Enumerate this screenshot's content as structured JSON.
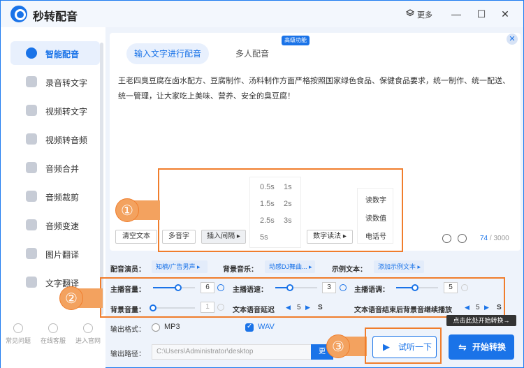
{
  "app": {
    "title": "秒转配音",
    "more": "更多",
    "min": "—",
    "max": "☐",
    "close": "✕"
  },
  "sidebar": {
    "items": [
      {
        "label": "智能配音",
        "active": true
      },
      {
        "label": "录音转文字"
      },
      {
        "label": "视频转文字"
      },
      {
        "label": "视频转音频"
      },
      {
        "label": "音频合并"
      },
      {
        "label": "音频裁剪"
      },
      {
        "label": "音频变速"
      },
      {
        "label": "图片翻译"
      },
      {
        "label": "文字翻译"
      }
    ],
    "footer": [
      "常见问题",
      "在线客服",
      "进入官网"
    ]
  },
  "tabs": {
    "input": "输入文字进行配音",
    "multi": "多人配音",
    "badge": "高级功能"
  },
  "text_content": "王老四臭豆腐在卤水配方、豆腐制作、汤料制作方面严格按照国家绿色食品、保健食品要求，统一制作、统一配送、统一管理，让大家吃上美味、营养、安全的臭豆腐！",
  "annotations": {
    "n1": "①",
    "n2": "②",
    "n3": "③"
  },
  "pauses": [
    "0.5s",
    "1s",
    "1.5s",
    "2s",
    "2.5s",
    "3s",
    "5s"
  ],
  "digit_options": [
    "读数字",
    "读数值",
    "电话号"
  ],
  "toolbar": {
    "clear": "清空文本",
    "polyphone": "多音字",
    "insert_pause": "插入间隔",
    "digit_reading": "数字读法"
  },
  "counter": {
    "current": "74",
    "total": " / 3000"
  },
  "settings": {
    "voice_label": "配音演员：",
    "voice_value": "知楠/广告男声",
    "bgm_label": "背景音乐：",
    "bgm_value": "动感DJ舞曲...",
    "sample_label": "示例文本：",
    "sample_value": "添加示例文本",
    "main_volume_label": "主播音量：",
    "main_volume": "6",
    "main_volume_level": 0.6,
    "speed_label": "主播语速：",
    "speed": "3",
    "speed_level": 0.35,
    "tone_label": "主播语调：",
    "tone": "5",
    "tone_level": 0.45,
    "bg_volume_label": "背景音量：",
    "bg_volume": "1",
    "bg_volume_level": 0.0,
    "delay_label": "文本语音延迟",
    "delay": "5",
    "delay_unit": "S",
    "continue_label": "文本语音结束后背景音继续播放",
    "continue": "5",
    "continue_unit": "S"
  },
  "output": {
    "format_label": "输出格式：",
    "mp3": "MP3",
    "wav": "WAV",
    "path_label": "输出路径：",
    "path": "C:\\Users\\Administrator\\desktop",
    "change": "更"
  },
  "buttons": {
    "trial": "试听一下",
    "start": "开始转换",
    "tooltip": "点击此处开始转换→"
  }
}
